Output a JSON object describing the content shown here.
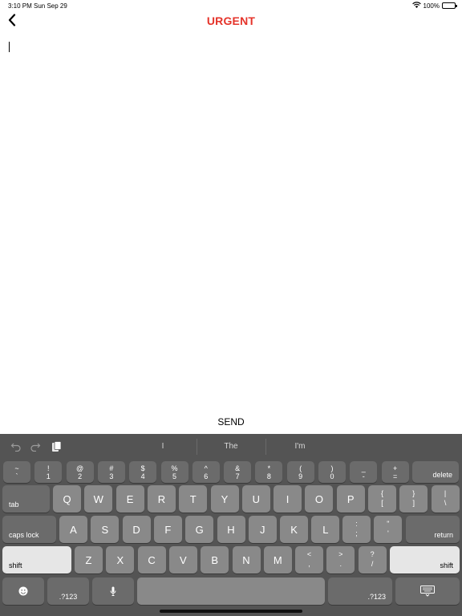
{
  "status_bar": {
    "time": "3:10 PM",
    "date": "Sun Sep 29",
    "battery": "100%"
  },
  "nav": {
    "title": "URGENT",
    "title_color": "#e5332a",
    "back_icon": "chevron-left-icon"
  },
  "message": {
    "text": ""
  },
  "send_label": "SEND",
  "keyboard": {
    "suggestions": [
      "I",
      "The",
      "I'm"
    ],
    "tools": [
      "undo-icon",
      "redo-icon",
      "paste-icon"
    ],
    "number_row": [
      {
        "top": "~",
        "bottom": "`"
      },
      {
        "top": "!",
        "bottom": "1"
      },
      {
        "top": "@",
        "bottom": "2"
      },
      {
        "top": "#",
        "bottom": "3"
      },
      {
        "top": "$",
        "bottom": "4"
      },
      {
        "top": "%",
        "bottom": "5"
      },
      {
        "top": "^",
        "bottom": "6"
      },
      {
        "top": "&",
        "bottom": "7"
      },
      {
        "top": "*",
        "bottom": "8"
      },
      {
        "top": "(",
        "bottom": "9"
      },
      {
        "top": ")",
        "bottom": "0"
      },
      {
        "top": "_",
        "bottom": "-"
      },
      {
        "top": "+",
        "bottom": "="
      }
    ],
    "delete_label": "delete",
    "tab_label": "tab",
    "row_q": [
      "Q",
      "W",
      "E",
      "R",
      "T",
      "Y",
      "U",
      "I",
      "O",
      "P"
    ],
    "row_q_symbols": [
      {
        "top": "{",
        "bottom": "["
      },
      {
        "top": "}",
        "bottom": "]"
      },
      {
        "top": "|",
        "bottom": "\\"
      }
    ],
    "caps_lock_label": "caps lock",
    "row_a": [
      "A",
      "S",
      "D",
      "F",
      "G",
      "H",
      "J",
      "K",
      "L"
    ],
    "row_a_symbols": [
      {
        "top": ":",
        "bottom": ";"
      },
      {
        "top": "\"",
        "bottom": "'"
      }
    ],
    "return_label": "return",
    "shift_label": "shift",
    "row_z": [
      "Z",
      "X",
      "C",
      "V",
      "B",
      "N",
      "M"
    ],
    "row_z_symbols": [
      {
        "top": "<",
        "bottom": ","
      },
      {
        "top": ">",
        "bottom": "."
      },
      {
        "top": "?",
        "bottom": "/"
      }
    ],
    "numbers_label": ".?123",
    "bottom_icons": [
      "emoji-icon",
      "microphone-icon",
      "keyboard-dismiss-icon"
    ]
  }
}
